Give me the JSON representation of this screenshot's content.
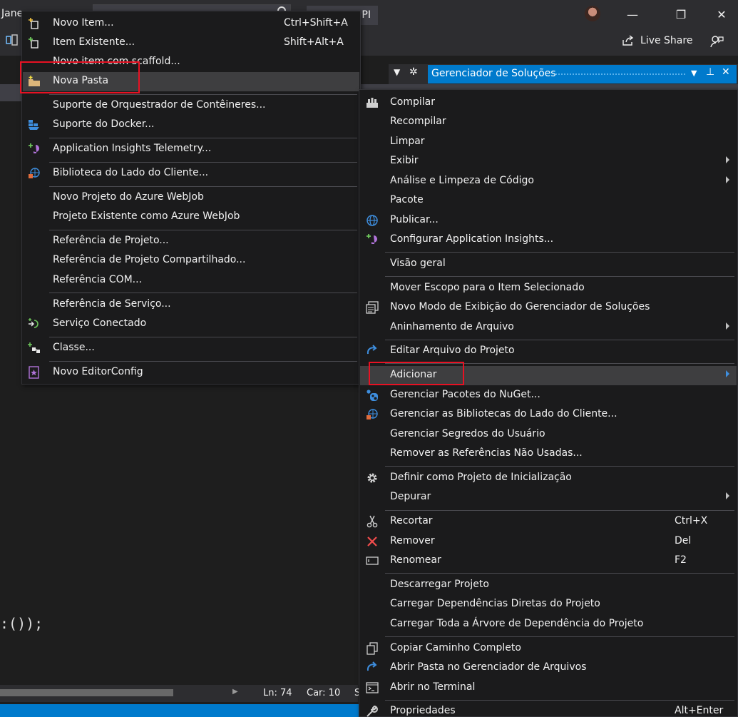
{
  "ide": {
    "menu_partial": "Jane",
    "title_tab_partial": "PI",
    "live_share_label": "Live Share",
    "code_text": ":());",
    "status_ln": "Ln: 74",
    "status_car": "Car: 10",
    "status_s": "S",
    "solution_explorer_title": "Gerenciador de Soluções"
  },
  "add_menu": {
    "items": [
      {
        "label": "Novo Item...",
        "shortcut": "Ctrl+Shift+A",
        "icon": "new-item-icon"
      },
      {
        "label": "Item Existente...",
        "shortcut": "Shift+Alt+A",
        "icon": "existing-item-icon"
      },
      {
        "label": "Novo item com scaffold...",
        "shortcut": "",
        "icon": ""
      },
      {
        "label": "Nova Pasta",
        "shortcut": "",
        "icon": "new-folder-icon",
        "highlighted": true
      },
      {
        "label": "Suporte de Orquestrador de Contêineres...",
        "shortcut": "",
        "icon": ""
      },
      {
        "label": "Suporte do Docker...",
        "shortcut": "",
        "icon": "docker-icon"
      },
      {
        "label": "Application Insights Telemetry...",
        "shortcut": "",
        "icon": "app-insights-icon"
      },
      {
        "label": "Biblioteca do Lado do Cliente...",
        "shortcut": "",
        "icon": "client-library-icon"
      },
      {
        "label": "Novo Projeto do Azure WebJob",
        "shortcut": "",
        "icon": ""
      },
      {
        "label": "Projeto Existente como Azure WebJob",
        "shortcut": "",
        "icon": ""
      },
      {
        "label": "Referência de Projeto...",
        "shortcut": "",
        "icon": ""
      },
      {
        "label": "Referência de Projeto Compartilhado...",
        "shortcut": "",
        "icon": ""
      },
      {
        "label": "Referência COM...",
        "shortcut": "",
        "icon": ""
      },
      {
        "label": "Referência de Serviço...",
        "shortcut": "",
        "icon": ""
      },
      {
        "label": "Serviço Conectado",
        "shortcut": "",
        "icon": "connected-service-icon"
      },
      {
        "label": "Classe...",
        "shortcut": "",
        "icon": "class-icon"
      },
      {
        "label": "Novo EditorConfig",
        "shortcut": "",
        "icon": "editorconfig-icon"
      }
    ]
  },
  "project_menu": {
    "items": [
      {
        "label": "Compilar",
        "shortcut": "",
        "icon": "build-icon"
      },
      {
        "label": "Recompilar",
        "shortcut": "",
        "icon": ""
      },
      {
        "label": "Limpar",
        "shortcut": "",
        "icon": ""
      },
      {
        "label": "Exibir",
        "shortcut": "",
        "icon": "",
        "submenu": true
      },
      {
        "label": "Análise e Limpeza de Código",
        "shortcut": "",
        "icon": "",
        "submenu": true
      },
      {
        "label": "Pacote",
        "shortcut": "",
        "icon": ""
      },
      {
        "label": "Publicar...",
        "shortcut": "",
        "icon": "publish-globe-icon"
      },
      {
        "label": "Configurar Application Insights...",
        "shortcut": "",
        "icon": "app-insights-icon"
      },
      {
        "label": "Visão geral",
        "shortcut": "",
        "icon": ""
      },
      {
        "label": "Mover Escopo para o Item Selecionado",
        "shortcut": "",
        "icon": ""
      },
      {
        "label": "Novo Modo de Exibição do Gerenciador de Soluções",
        "shortcut": "",
        "icon": "new-view-icon"
      },
      {
        "label": "Aninhamento de Arquivo",
        "shortcut": "",
        "icon": "",
        "submenu": true
      },
      {
        "label": "Editar Arquivo do Projeto",
        "shortcut": "",
        "icon": "edit-project-icon"
      },
      {
        "label": "Adicionar",
        "shortcut": "",
        "icon": "",
        "submenu": true,
        "highlighted": true
      },
      {
        "label": "Gerenciar Pacotes do NuGet...",
        "shortcut": "",
        "icon": "nuget-icon"
      },
      {
        "label": "Gerenciar as Bibliotecas do Lado do Cliente...",
        "shortcut": "",
        "icon": "client-library-icon"
      },
      {
        "label": "Gerenciar Segredos do Usuário",
        "shortcut": "",
        "icon": ""
      },
      {
        "label": "Remover as Referências Não Usadas...",
        "shortcut": "",
        "icon": ""
      },
      {
        "label": "Definir como Projeto de Inicialização",
        "shortcut": "",
        "icon": "gear-icon"
      },
      {
        "label": "Depurar",
        "shortcut": "",
        "icon": "",
        "submenu": true
      },
      {
        "label": "Recortar",
        "shortcut": "Ctrl+X",
        "icon": "scissors-icon"
      },
      {
        "label": "Remover",
        "shortcut": "Del",
        "icon": "remove-x-icon"
      },
      {
        "label": "Renomear",
        "shortcut": "F2",
        "icon": "rename-icon"
      },
      {
        "label": "Descarregar Projeto",
        "shortcut": "",
        "icon": ""
      },
      {
        "label": "Carregar Dependências Diretas do Projeto",
        "shortcut": "",
        "icon": ""
      },
      {
        "label": "Carregar Toda a Árvore de Dependência do Projeto",
        "shortcut": "",
        "icon": ""
      },
      {
        "label": "Copiar Caminho Completo",
        "shortcut": "",
        "icon": "copy-path-icon"
      },
      {
        "label": "Abrir Pasta no Gerenciador de Arquivos",
        "shortcut": "",
        "icon": "open-folder-arrow-icon"
      },
      {
        "label": "Abrir no Terminal",
        "shortcut": "",
        "icon": "terminal-icon"
      },
      {
        "label": "Propriedades",
        "shortcut": "Alt+Enter",
        "icon": "wrench-icon"
      }
    ]
  }
}
